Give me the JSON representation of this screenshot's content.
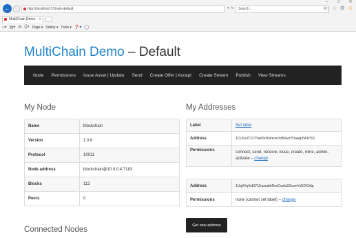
{
  "browser": {
    "window_controls": [
      "–",
      "□",
      "✕"
    ],
    "address": "http://localhost:7/chain-default",
    "search_placeholder": "Search...",
    "tab_title": "MultiChain Demo",
    "command_bar": {
      "page": "Page ▾",
      "safety": "Safety ▾",
      "tools": "Tools ▾"
    },
    "icons": {
      "back": "arrow-left-icon",
      "forward": "arrow-right-icon",
      "refresh": "refresh-icon",
      "search": "search-icon",
      "home": "home-icon",
      "favorites": "star-icon",
      "settings": "gear-icon",
      "feedback": "smiley-icon"
    }
  },
  "page": {
    "title_brand": "MultiChain Demo",
    "title_suffix": " – Default",
    "brand_color": "#1e83c6"
  },
  "nav": {
    "items": [
      "Node",
      "Permissions",
      "Issue Asset | Update",
      "Send",
      "Create Offer | Accept",
      "Create Stream",
      "Publish",
      "View Streams"
    ]
  },
  "my_node": {
    "title": "My Node",
    "rows": [
      {
        "label": "Name",
        "value": "blockchain"
      },
      {
        "label": "Version",
        "value": "1.0.6"
      },
      {
        "label": "Protocol",
        "value": "10011"
      },
      {
        "label": "Node address",
        "value": "blockchain@10.0.0.4:7183"
      },
      {
        "label": "Blocks",
        "value": "112"
      },
      {
        "label": "Peers",
        "value": "0"
      }
    ]
  },
  "connected_nodes": {
    "title": "Connected Nodes"
  },
  "my_addresses": {
    "title": "My Addresses",
    "address1": {
      "label_key": "Label",
      "label_value": "Set label",
      "address_key": "Address",
      "address_value": "1CLKw7C17Yuk65n6NmcmXdB4vzYDawgr5A1H15",
      "permissions_key": "Permissions",
      "permissions_value": "connect, send, receive, issue, create, mine, admin, activate – ",
      "permissions_link": "change"
    },
    "address2": {
      "address_key": "Address",
      "address_value": "1Uq9Vq4nE6YZnpsabhRseCozfu2ZsvmYdK2K3dp",
      "permissions_key": "Permissions",
      "permissions_value": "none (cannot set label) – ",
      "permissions_link": "change"
    },
    "new_address_button": "Get new address"
  }
}
